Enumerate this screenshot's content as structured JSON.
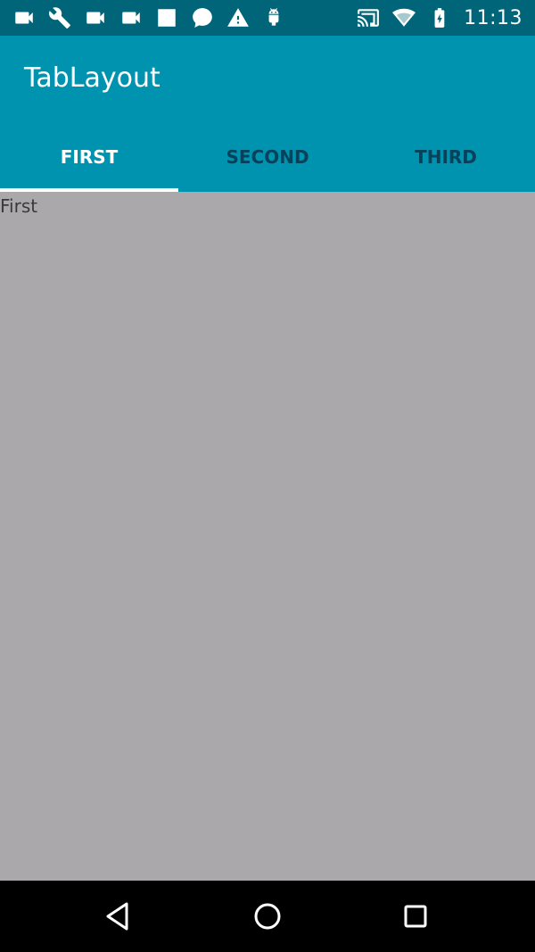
{
  "status_bar": {
    "time": "11:13",
    "left_icons": [
      "videocam-icon",
      "wrench-icon",
      "videocam-icon",
      "videocam-icon",
      "square-icon",
      "chat-bubble-icon",
      "warning-icon",
      "android-icon"
    ],
    "right_icons": [
      "cast-icon",
      "wifi-icon",
      "battery-icon"
    ]
  },
  "app_bar": {
    "title": "TabLayout"
  },
  "tabs": [
    {
      "label": "FIRST",
      "selected": true
    },
    {
      "label": "SECOND",
      "selected": false
    },
    {
      "label": "THIRD",
      "selected": false
    }
  ],
  "content": {
    "text": "First"
  },
  "nav_bar": {
    "buttons": [
      "back-icon",
      "home-icon",
      "recents-icon"
    ]
  },
  "colors": {
    "status_bar": "#006579",
    "app_bar": "#0093b0",
    "tab_active_text": "#ffffff",
    "tab_inactive_text": "#06425a",
    "content_background": "#aaa8aa"
  }
}
